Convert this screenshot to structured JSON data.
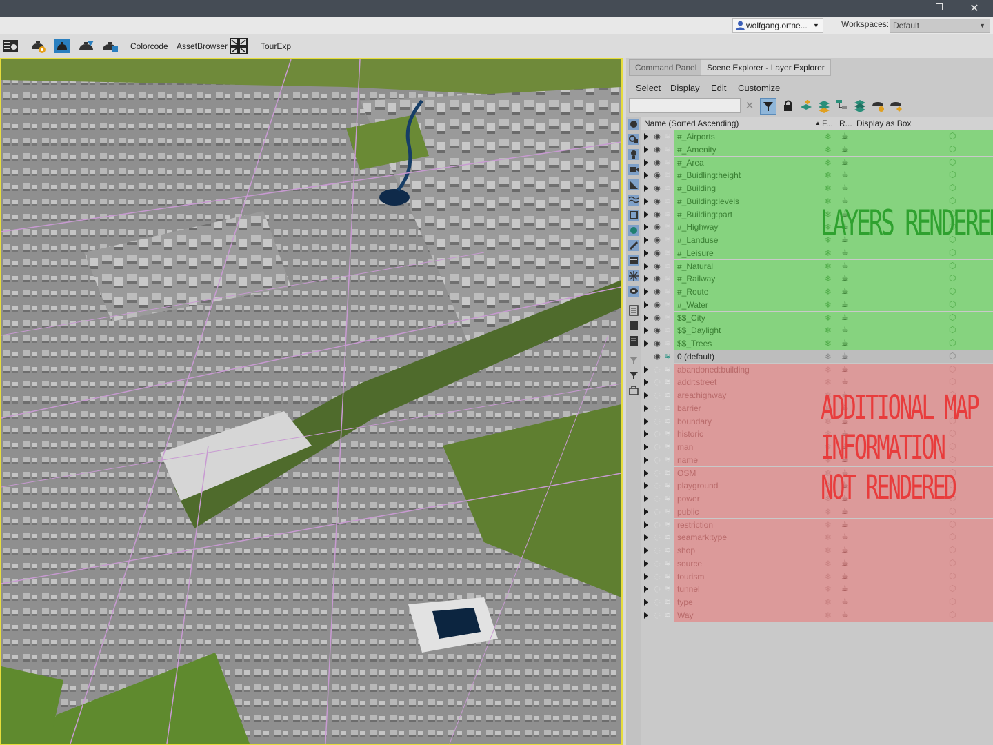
{
  "window": {
    "minimize_glyph": "—",
    "restore_glyph": "❐",
    "close_glyph": "✕"
  },
  "infobar": {
    "user": "wolfgang.ortne...",
    "workspaces_label": "Workspaces:",
    "workspace_value": "Default"
  },
  "toolbar": {
    "colorcode": "Colorcode",
    "assetbrowser": "AssetBrowser",
    "tourexp": "TourExp"
  },
  "panel": {
    "tabs": [
      "Command Panel",
      "Scene Explorer - Layer Explorer"
    ],
    "menu": [
      "Select",
      "Display",
      "Edit",
      "Customize"
    ],
    "columns": {
      "name": "Name (Sorted Ascending)",
      "sort_glyph": "▲",
      "frozen": "F...",
      "renderable": "R...",
      "display_as_box": "Display as Box"
    },
    "layers_rendered": [
      "#_Airports",
      "#_Amenity",
      "#_Area",
      "#_Buidling:height",
      "#_Building",
      "#_Building:levels",
      "#_Building:part",
      "#_Highway",
      "#_Landuse",
      "#_Leisure",
      "#_Natural",
      "#_Railway",
      "#_Route",
      "#_Water",
      "$$_City",
      "$$_Daylight",
      "$$_Trees"
    ],
    "default_layer": "0 (default)",
    "layers_not_rendered": [
      "abandoned:building",
      "addr:street",
      "area:highway",
      "barrier",
      "boundary",
      "historic",
      "man",
      "name",
      "OSM",
      "playground",
      "power",
      "public",
      "restriction",
      "seamark:type",
      "shop",
      "source",
      "tourism",
      "tunnel",
      "type",
      "Way"
    ],
    "annotations": {
      "rendered": "LAYERS RENDERED",
      "not_rendered": [
        "ADDITIONAL MAP",
        "INFORMATION",
        "NOT RENDERED"
      ]
    }
  },
  "colors": {
    "green_row": "#86d37f",
    "red_row": "#dc9a9a",
    "green_text": "#2fa12f",
    "red_text": "#e83c3c",
    "viewport_border": "#e6dc3c"
  }
}
